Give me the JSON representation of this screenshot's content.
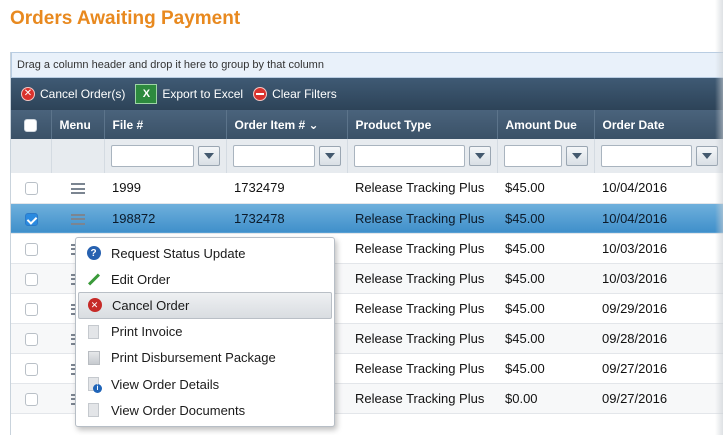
{
  "page": {
    "title": "Orders Awaiting Payment"
  },
  "grid": {
    "group_hint": "Drag a column header and drop it here to group by that column",
    "toolbar": {
      "cancel_orders": "Cancel Order(s)",
      "export_excel": "Export to Excel",
      "clear_filters": "Clear Filters"
    },
    "columns": [
      "Menu",
      "File #",
      "Order Item # ⌄",
      "Product Type",
      "Amount Due",
      "Order Date"
    ],
    "rows": [
      {
        "file": "1999",
        "order_item": "1732479",
        "product": "Release Tracking Plus",
        "amount": "$45.00",
        "date": "10/04/2016",
        "checked": false
      },
      {
        "file": "198872",
        "order_item": "1732478",
        "product": "Release Tracking Plus",
        "amount": "$45.00",
        "date": "10/04/2016",
        "checked": true
      },
      {
        "file": "",
        "order_item": "",
        "product": "Release Tracking Plus",
        "amount": "$45.00",
        "date": "10/03/2016",
        "checked": false
      },
      {
        "file": "",
        "order_item": "",
        "product": "Release Tracking Plus",
        "amount": "$45.00",
        "date": "10/03/2016",
        "checked": false
      },
      {
        "file": "",
        "order_item": "",
        "product": "Release Tracking Plus",
        "amount": "$45.00",
        "date": "09/29/2016",
        "checked": false
      },
      {
        "file": "",
        "order_item": "",
        "product": "Release Tracking Plus",
        "amount": "$45.00",
        "date": "09/28/2016",
        "checked": false
      },
      {
        "file": "",
        "order_item": "",
        "product": "Release Tracking Plus",
        "amount": "$45.00",
        "date": "09/27/2016",
        "checked": false
      },
      {
        "file": "",
        "order_item": "",
        "product": "Release Tracking Plus",
        "amount": "$0.00",
        "date": "09/27/2016",
        "checked": false
      }
    ]
  },
  "context_menu": {
    "items": [
      {
        "label": "Request Status Update",
        "icon": "help-icon"
      },
      {
        "label": "Edit Order",
        "icon": "edit-icon"
      },
      {
        "label": "Cancel Order",
        "icon": "cancel-icon"
      },
      {
        "label": "Print Invoice",
        "icon": "document-icon"
      },
      {
        "label": "Print Disbursement Package",
        "icon": "package-icon"
      },
      {
        "label": "View Order Details",
        "icon": "info-icon"
      },
      {
        "label": "View Order Documents",
        "icon": "document-icon"
      }
    ]
  },
  "colors": {
    "title": "#e8891f",
    "toolbar": "#2d4358",
    "header": "#3a5167",
    "selected_row": "#3f8fca"
  }
}
